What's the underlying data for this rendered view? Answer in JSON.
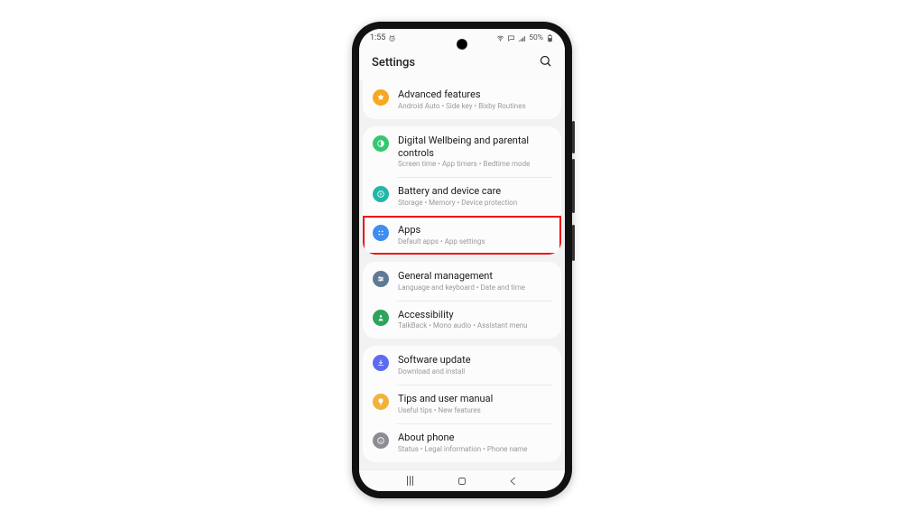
{
  "statusbar": {
    "time": "1:55",
    "battery": "50%"
  },
  "header": {
    "title": "Settings"
  },
  "groups": [
    {
      "items": [
        {
          "id": "advanced-features",
          "icon": "star",
          "iconClass": "ic-orange",
          "title": "Advanced features",
          "subtitle": "Android Auto  •  Side key  •  Bixby Routines"
        }
      ]
    },
    {
      "items": [
        {
          "id": "digital-wellbeing",
          "icon": "wellbeing",
          "iconClass": "ic-green",
          "title": "Digital Wellbeing and parental controls",
          "subtitle": "Screen time  •  App timers  •  Bedtime mode"
        },
        {
          "id": "battery-care",
          "icon": "battery",
          "iconClass": "ic-teal",
          "title": "Battery and device care",
          "subtitle": "Storage  •  Memory  •  Device protection"
        },
        {
          "id": "apps",
          "icon": "grid",
          "iconClass": "ic-blue",
          "title": "Apps",
          "subtitle": "Default apps  •  App settings",
          "highlighted": true
        }
      ]
    },
    {
      "items": [
        {
          "id": "general-management",
          "icon": "sliders",
          "iconClass": "ic-slate",
          "title": "General management",
          "subtitle": "Language and keyboard  •  Date and time"
        },
        {
          "id": "accessibility",
          "icon": "person",
          "iconClass": "ic-green2",
          "title": "Accessibility",
          "subtitle": "TalkBack  •  Mono audio  •  Assistant menu"
        }
      ]
    },
    {
      "items": [
        {
          "id": "software-update",
          "icon": "download",
          "iconClass": "ic-indigo",
          "title": "Software update",
          "subtitle": "Download and install"
        },
        {
          "id": "tips",
          "icon": "bulb",
          "iconClass": "ic-yellow",
          "title": "Tips and user manual",
          "subtitle": "Useful tips  •  New features"
        },
        {
          "id": "about-phone",
          "icon": "info",
          "iconClass": "ic-grey",
          "title": "About phone",
          "subtitle": "Status  •  Legal information  •  Phone name"
        }
      ]
    }
  ]
}
